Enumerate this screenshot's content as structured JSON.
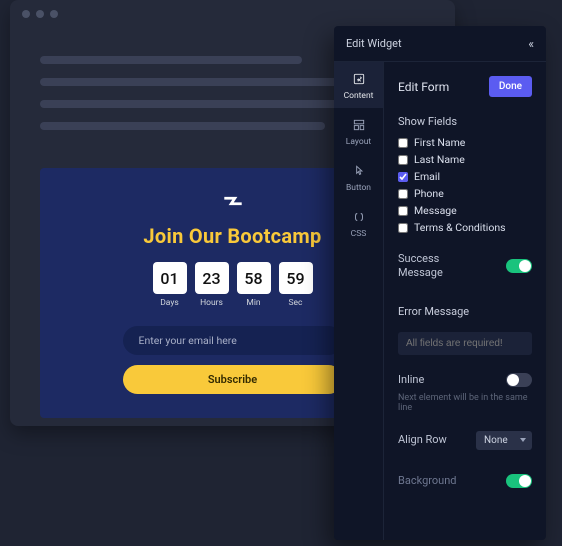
{
  "preview": {
    "title": "Join Our Bootcamp",
    "countdown": [
      {
        "value": "01",
        "label": "Days"
      },
      {
        "value": "23",
        "label": "Hours"
      },
      {
        "value": "58",
        "label": "Min"
      },
      {
        "value": "59",
        "label": "Sec"
      }
    ],
    "email_placeholder": "Enter your email here",
    "subscribe_label": "Subscribe"
  },
  "panel": {
    "title": "Edit Widget",
    "rail": [
      {
        "label": "Content"
      },
      {
        "label": "Layout"
      },
      {
        "label": "Button"
      },
      {
        "label": "CSS"
      }
    ],
    "form_heading": "Edit Form",
    "done_label": "Done",
    "show_fields_label": "Show Fields",
    "fields": [
      {
        "label": "First Name",
        "checked": false
      },
      {
        "label": "Last Name",
        "checked": false
      },
      {
        "label": "Email",
        "checked": true
      },
      {
        "label": "Phone",
        "checked": false
      },
      {
        "label": "Message",
        "checked": false
      },
      {
        "label": "Terms & Conditions",
        "checked": false
      }
    ],
    "success_label_line1": "Success",
    "success_label_line2": "Message",
    "success_enabled": true,
    "error_label": "Error Message",
    "error_placeholder": "All fields are required!",
    "inline_label": "Inline",
    "inline_enabled": false,
    "inline_hint": "Next element will be in the same line",
    "align_label": "Align Row",
    "align_value": "None",
    "background_label": "Background",
    "background_enabled": true
  }
}
